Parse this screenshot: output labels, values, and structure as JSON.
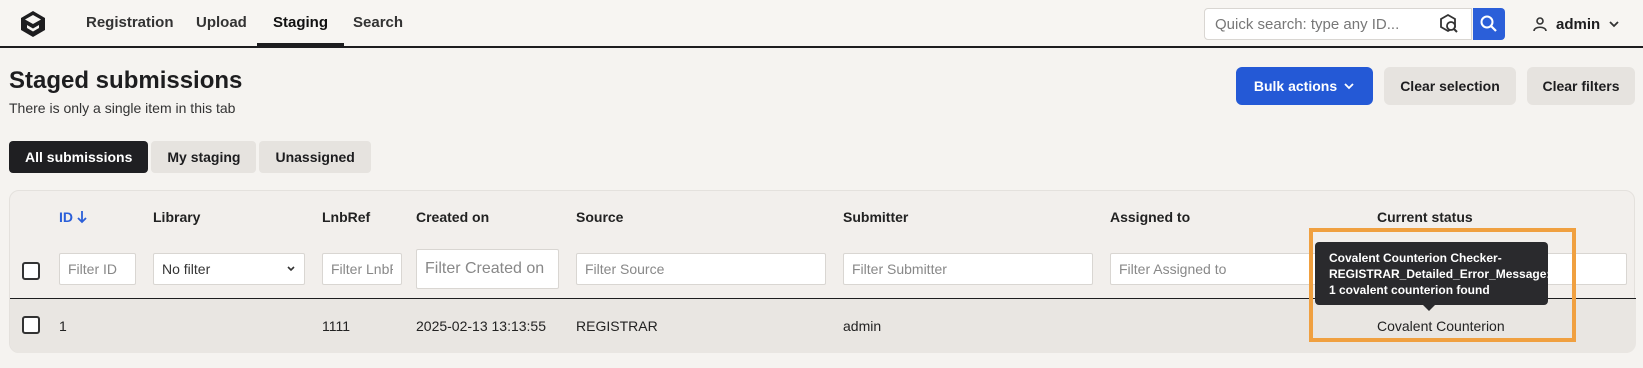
{
  "nav": {
    "items": [
      {
        "label": "Registration"
      },
      {
        "label": "Upload"
      },
      {
        "label": "Staging"
      },
      {
        "label": "Search"
      }
    ],
    "active": "Staging",
    "quick_search_placeholder": "Quick search: type any ID...",
    "user": "admin"
  },
  "page": {
    "title": "Staged submissions",
    "subtitle": "There is only a single item in this tab"
  },
  "actions": {
    "bulk": "Bulk actions",
    "clear_selection": "Clear selection",
    "clear_filters": "Clear filters"
  },
  "tabs": [
    {
      "label": "All submissions"
    },
    {
      "label": "My staging"
    },
    {
      "label": "Unassigned"
    }
  ],
  "table": {
    "columns": {
      "id": "ID",
      "library": "Library",
      "lnbref": "LnbRef",
      "created_on": "Created on",
      "source": "Source",
      "submitter": "Submitter",
      "assigned_to": "Assigned to",
      "current_status": "Current status"
    },
    "filters": {
      "id": "Filter ID",
      "library": "No filter",
      "lnbref": "Filter LnbRef",
      "created_on": "Filter Created on",
      "source": "Filter Source",
      "submitter": "Filter Submitter",
      "assigned_to": "Filter Assigned to"
    },
    "rows": [
      {
        "id": "1",
        "library": "",
        "lnbref": "1111",
        "created_on": "2025-02-13 13:13:55",
        "source": "REGISTRAR",
        "submitter": "admin",
        "assigned_to": "",
        "current_status": "Covalent Counterion"
      }
    ]
  },
  "tooltip": {
    "line1": "Covalent Counterion Checker-",
    "line2": "REGISTRAR_Detailed_Error_Message:",
    "line3": "1 covalent counterion found"
  },
  "colors": {
    "primary": "#2459d6",
    "highlight": "#f0a040",
    "tab_active": "#1f1f22"
  }
}
